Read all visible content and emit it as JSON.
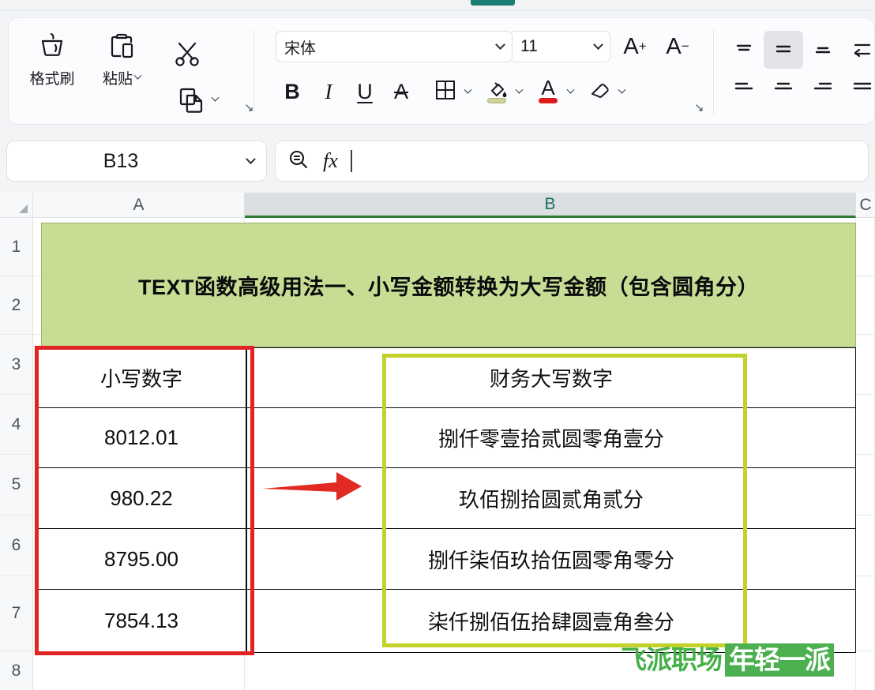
{
  "app": {
    "tab_active_indicator": true
  },
  "ribbon": {
    "clipboard": {
      "format_painter": {
        "label": "格式刷",
        "icon": "format-painter-icon"
      },
      "paste": {
        "label": "粘贴",
        "icon": "paste-icon",
        "has_caret": true
      },
      "cut": {
        "icon": "scissors-icon"
      },
      "copy": {
        "icon": "copy-icon",
        "has_caret": true
      },
      "dialog_launcher": "↘"
    },
    "font": {
      "font_name": "宋体",
      "font_size": "11",
      "grow_font": "A",
      "grow_font_sup": "+",
      "shrink_font": "A",
      "shrink_font_sup": "−",
      "bold": "B",
      "italic": "I",
      "underline": "U",
      "strikethrough": "A",
      "borders_icon": "borders-icon",
      "fill_color_icon": "fill-color-icon",
      "fill_color": "#cfd29a",
      "font_color_icon": "font-color-icon",
      "font_color": "#e01b1b",
      "clear_format_icon": "eraser-icon",
      "dialog_launcher": "↘"
    },
    "align": {
      "top_align": "align-top",
      "middle_align": "align-middle",
      "bottom_align": "align-bottom",
      "wrap_text": "wrap-text",
      "align_left": "align-left",
      "align_center": "align-center",
      "align_right": "align-right",
      "align_justify": "align-justify",
      "selected": "align-middle"
    }
  },
  "formula_bar": {
    "name_box_value": "B13",
    "search_icon": "search-icon",
    "fx_label": "fx",
    "formula_value": ""
  },
  "sheet": {
    "column_headers": [
      "A",
      "B",
      "C"
    ],
    "selected_column": "B",
    "row_headers": [
      "1",
      "2",
      "3",
      "4",
      "5",
      "6",
      "7",
      "8"
    ],
    "title": "TEXT函数高级用法一、小写金额转换为大写金额（包含圆角分）",
    "title_bg_color": "#c7dd94",
    "table": {
      "headers": [
        "小写数字",
        "财务大写数字"
      ],
      "rows": [
        {
          "row": "4",
          "lower": "8012.01",
          "upper": "捌仟零壹拾贰圆零角壹分"
        },
        {
          "row": "5",
          "lower": "980.22",
          "upper": "玖佰捌拾圆贰角贰分"
        },
        {
          "row": "6",
          "lower": "8795.00",
          "upper": "捌仟柒佰玖拾伍圆零角零分"
        },
        {
          "row": "7",
          "lower": "7854.13",
          "upper": "柒仟捌佰伍拾肆圆壹角叁分"
        }
      ]
    },
    "annotations": {
      "red_box_color": "#e02424",
      "lime_box_color": "#c2d22a",
      "arrow_color": "#e02a22",
      "arrow_direction": "right"
    }
  },
  "watermark": {
    "text_green": "飞派职场",
    "text_badge": "年轻一派",
    "green": "#46b04a"
  }
}
